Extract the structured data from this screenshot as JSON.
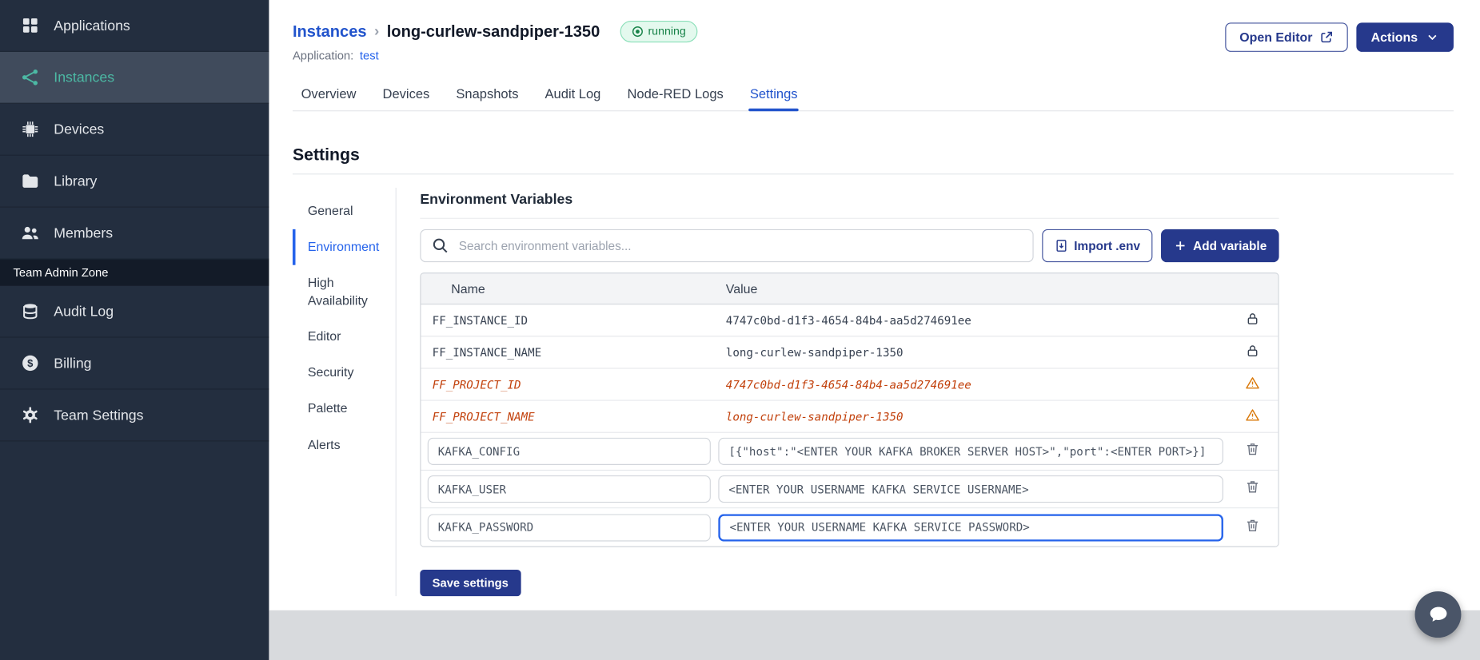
{
  "colors": {
    "primary": "#26398C",
    "link_blue": "#2254CC",
    "teal": "#4CB9A4",
    "sidebar_bg": "#232E3F",
    "sidebar_active_bg": "#404B5C",
    "sidebar_section_bg": "#131B28",
    "warning": "#C2410C",
    "running_text": "#178248",
    "running_bg": "#E4F9EE",
    "running_border": "#8ADFB8",
    "footer_gray": "#D8DADD"
  },
  "sidebar": {
    "items": [
      {
        "label": "Applications"
      },
      {
        "label": "Instances"
      },
      {
        "label": "Devices"
      },
      {
        "label": "Library"
      },
      {
        "label": "Members"
      }
    ],
    "section_label": "Team Admin Zone",
    "admin_items": [
      {
        "label": "Audit Log"
      },
      {
        "label": "Billing"
      },
      {
        "label": "Team Settings"
      }
    ]
  },
  "header": {
    "breadcrumb": "Instances",
    "separator": "›",
    "title": "long-curlew-sandpiper-1350",
    "status": "running",
    "application_label": "Application:",
    "application_name": "test",
    "open_editor_label": "Open Editor",
    "actions_label": "Actions"
  },
  "tabs": [
    "Overview",
    "Devices",
    "Snapshots",
    "Audit Log",
    "Node-RED Logs",
    "Settings"
  ],
  "settings": {
    "title": "Settings",
    "nav": [
      "General",
      "Environment",
      "High Availability",
      "Editor",
      "Security",
      "Palette",
      "Alerts"
    ]
  },
  "env": {
    "title": "Environment Variables",
    "search_placeholder": "Search environment variables...",
    "import_label": "Import .env",
    "add_label": "Add variable",
    "save_label": "Save settings",
    "columns": [
      "Name",
      "Value"
    ],
    "rows": [
      {
        "name": "FF_INSTANCE_ID",
        "value": "4747c0bd-d1f3-4654-84b4-aa5d274691ee",
        "state": "locked"
      },
      {
        "name": "FF_INSTANCE_NAME",
        "value": "long-curlew-sandpiper-1350",
        "state": "locked"
      },
      {
        "name": "FF_PROJECT_ID",
        "value": "4747c0bd-d1f3-4654-84b4-aa5d274691ee",
        "state": "deprecated"
      },
      {
        "name": "FF_PROJECT_NAME",
        "value": "long-curlew-sandpiper-1350",
        "state": "deprecated"
      },
      {
        "name": "KAFKA_CONFIG",
        "value": "[{\"host\":\"<ENTER YOUR KAFKA BROKER SERVER HOST>\",\"port\":<ENTER PORT>}]",
        "state": "editable"
      },
      {
        "name": "KAFKA_USER",
        "value": "<ENTER YOUR USERNAME KAFKA SERVICE USERNAME>",
        "state": "editable"
      },
      {
        "name": "KAFKA_PASSWORD",
        "value": "<ENTER YOUR USERNAME KAFKA SERVICE PASSWORD>",
        "state": "editable",
        "focused": true
      }
    ]
  }
}
